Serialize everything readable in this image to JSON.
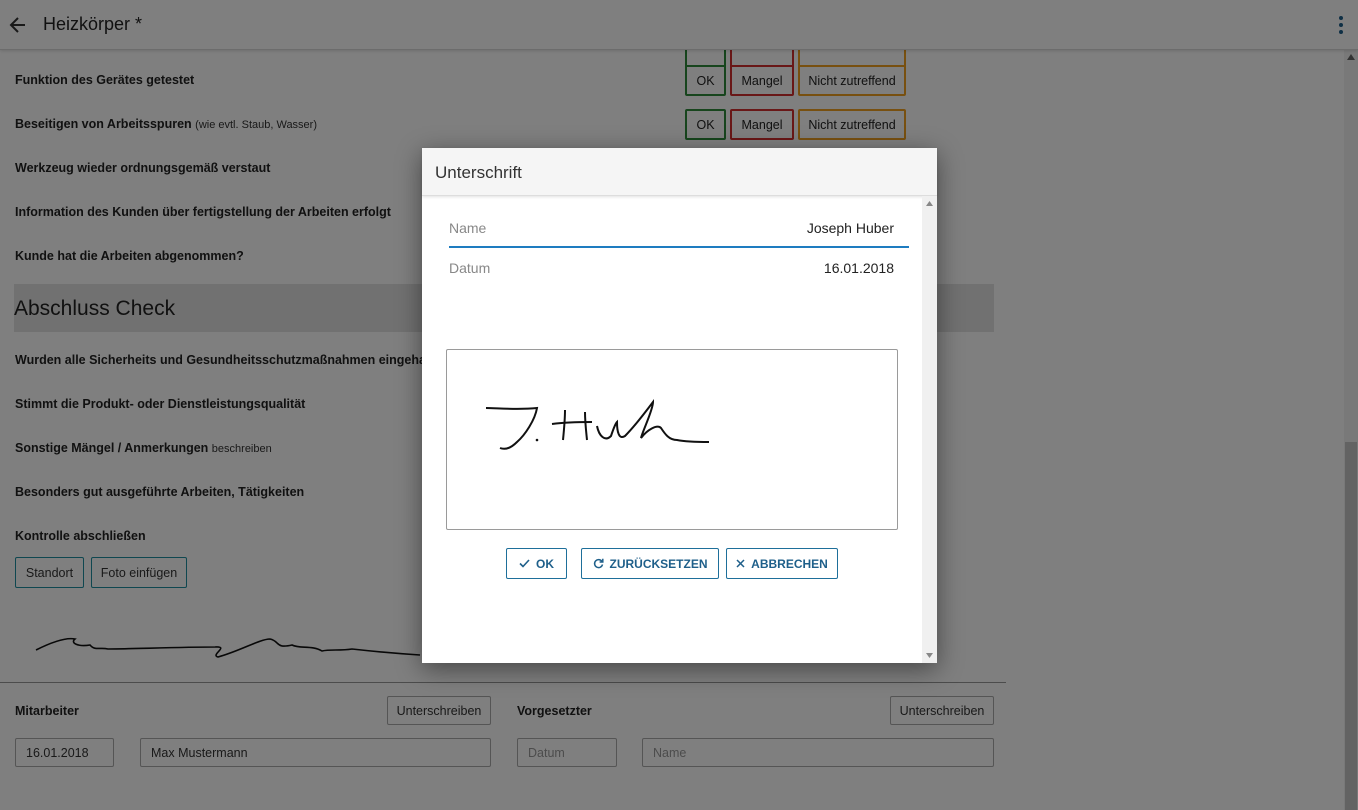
{
  "appbar": {
    "title": "Heizkörper *",
    "back_icon": "arrow-left-icon",
    "menu_icon": "more-vertical-icon"
  },
  "checklist": {
    "rows": [
      {
        "label": "Funktion des Gerätes getestet",
        "note": ""
      },
      {
        "label": "Beseitigen von Arbeitsspuren",
        "note": "(wie evtl. Staub, Wasser)"
      },
      {
        "label": "Werkzeug wieder ordnungsgemäß verstaut",
        "note": ""
      },
      {
        "label": "Information des Kunden über fertigstellung der Arbeiten erfolgt",
        "note": ""
      },
      {
        "label": "Kunde hat die Arbeiten abgenommen?",
        "note": ""
      }
    ],
    "options": {
      "ok": "OK",
      "mangel": "Mangel",
      "nz": "Nicht zutreffend"
    },
    "section_title": "Abschluss Check",
    "check_rows": [
      {
        "label": "Wurden alle Sicherheits und Gesundheitsschutzmaßnahmen eingehalte",
        "note": ""
      },
      {
        "label": "Stimmt die Produkt- oder Dienstleistungsqualität",
        "note": ""
      },
      {
        "label": "Sonstige Mängel / Anmerkungen",
        "note": "beschreiben"
      },
      {
        "label": "Besonders gut ausgeführte Arbeiten, Tätigkeiten",
        "note": ""
      },
      {
        "label": "Kontrolle abschließen",
        "note": ""
      }
    ],
    "standort_button": "Standort",
    "foto_button": "Foto einfügen"
  },
  "signatures": {
    "mitarbeiter": {
      "label": "Mitarbeiter",
      "sign_button": "Unterschreiben",
      "date": "16.01.2018",
      "name": "Max Mustermann"
    },
    "vorgesetzter": {
      "label": "Vorgesetzter",
      "sign_button": "Unterschreiben",
      "date_placeholder": "Datum",
      "name_placeholder": "Name"
    }
  },
  "dialog": {
    "title": "Unterschrift",
    "name_label": "Name",
    "name_value": "Joseph Huber",
    "date_label": "Datum",
    "date_value": "16.01.2018",
    "ok_button": "OK",
    "reset_button": "ZURÜCKSETZEN",
    "cancel_button": "ABBRECHEN",
    "accent_color": "#1e6f9a"
  },
  "colors": {
    "ok": "#2e8b3a",
    "mangel": "#d32f2f",
    "nicht_zutreffend": "#f0a020",
    "accent": "#1e8fa0"
  }
}
